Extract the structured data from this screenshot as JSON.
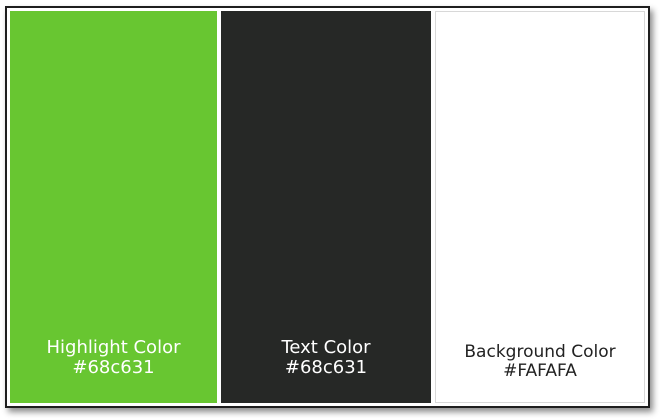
{
  "swatches": [
    {
      "name": "Highlight Color",
      "value": "#68c631",
      "fill": "#68c631",
      "text_color": "#ffffff"
    },
    {
      "name": "Text Color",
      "value": "#68c631",
      "fill": "#262826",
      "text_color": "#ffffff"
    },
    {
      "name": "Background Color",
      "value": "#FAFAFA",
      "fill": "#ffffff",
      "text_color": "#222222"
    }
  ]
}
